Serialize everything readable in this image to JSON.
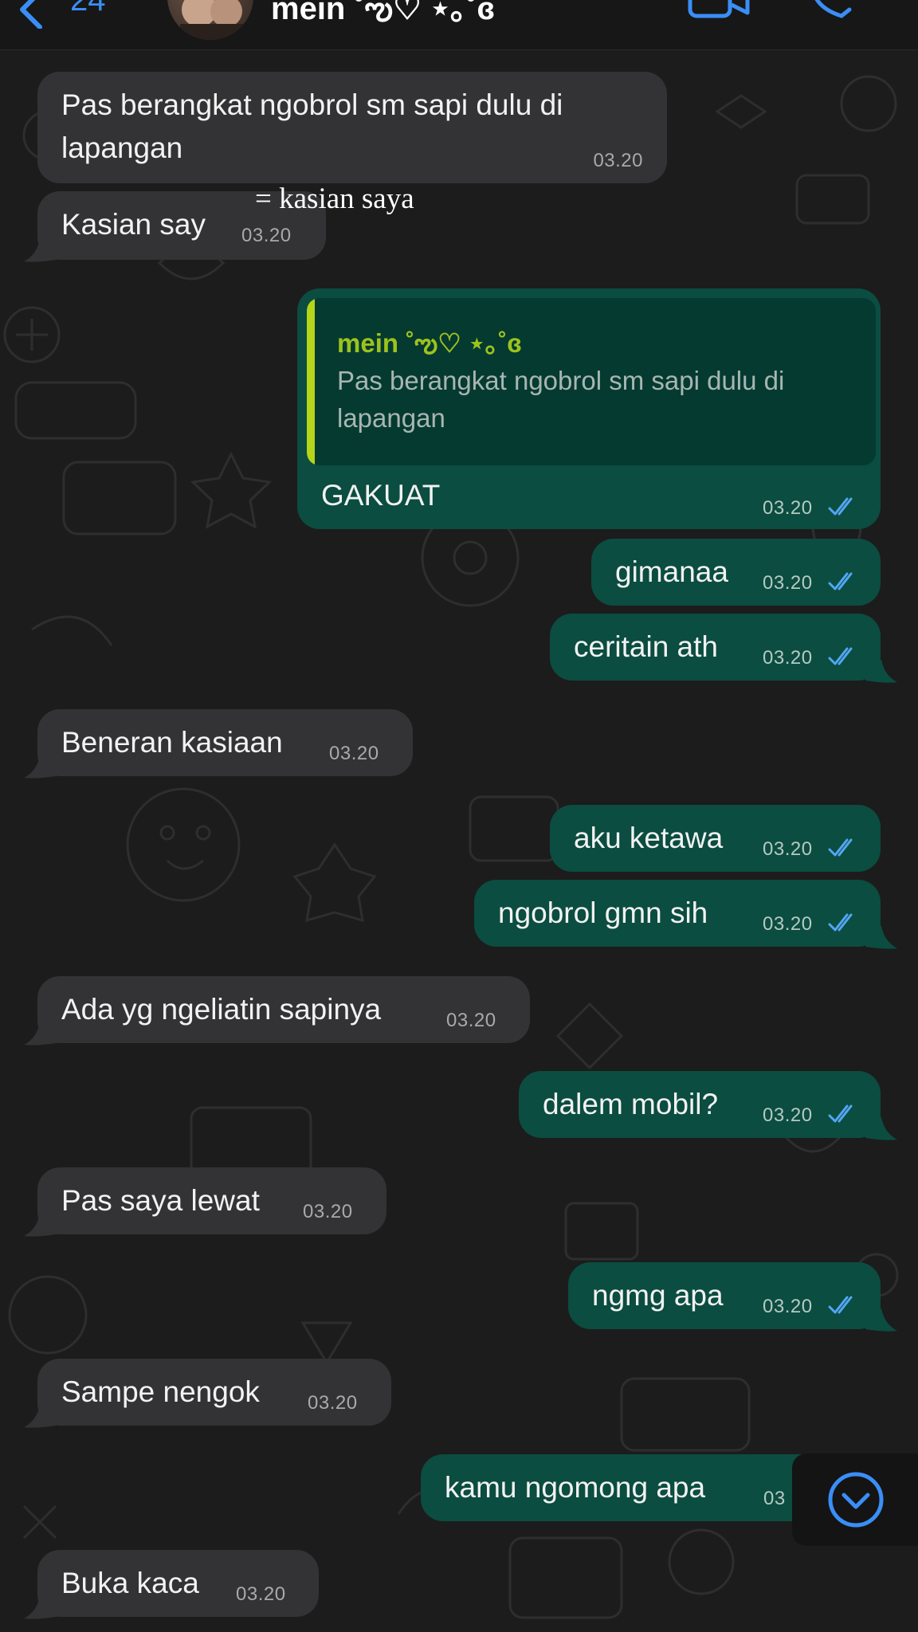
{
  "header": {
    "back_count": "24",
    "contact_name": "mein ˚ఌ♡ ⋆｡˚ɞ",
    "icons": [
      "chevron-left-icon",
      "video-camera-icon",
      "phone-icon"
    ]
  },
  "annotation": "= kasian saya",
  "messages": [
    {
      "dir": "in",
      "text_lines": [
        "Pas berangkat ngobrol sm sapi dulu di",
        "lapangan"
      ],
      "time": "03.20"
    },
    {
      "dir": "in",
      "text": "Kasian say",
      "time": "03.20"
    },
    {
      "dir": "out",
      "reply_to": {
        "name": "mein ˚ఌ♡ ⋆｡˚ɞ",
        "text": "Pas berangkat ngobrol sm sapi dulu di lapangan"
      },
      "text": "GAKUAT",
      "time": "03.20",
      "status": "read"
    },
    {
      "dir": "out",
      "text": "gimanaa",
      "time": "03.20",
      "status": "read"
    },
    {
      "dir": "out",
      "text": "ceritain ath",
      "time": "03.20",
      "status": "read"
    },
    {
      "dir": "in",
      "text": "Beneran kasiaan",
      "time": "03.20"
    },
    {
      "dir": "out",
      "text": "aku ketawa",
      "time": "03.20",
      "status": "read"
    },
    {
      "dir": "out",
      "text": "ngobrol gmn sih",
      "time": "03.20",
      "status": "read"
    },
    {
      "dir": "in",
      "text": "Ada yg ngeliatin sapinya",
      "time": "03.20"
    },
    {
      "dir": "out",
      "text": "dalem mobil?",
      "time": "03.20",
      "status": "read"
    },
    {
      "dir": "in",
      "text": "Pas saya lewat",
      "time": "03.20"
    },
    {
      "dir": "out",
      "text": "ngmg apa",
      "time": "03.20",
      "status": "read"
    },
    {
      "dir": "in",
      "text": "Sampe nengok",
      "time": "03.20"
    },
    {
      "dir": "out",
      "text": "kamu ngomong apa",
      "time": "03",
      "status": "read"
    },
    {
      "dir": "in",
      "text": "Buka kaca",
      "time": "03.20"
    }
  ],
  "scroll_button": {
    "icon": "chevron-down-circle-icon"
  },
  "colors": {
    "background": "#1c1c1c",
    "incoming_bubble": "#333335",
    "outgoing_bubble": "#0b4d40",
    "quote_bar": "#b6d41a",
    "read_ticks": "#53a6f4",
    "accent": "#3a8ef6"
  }
}
